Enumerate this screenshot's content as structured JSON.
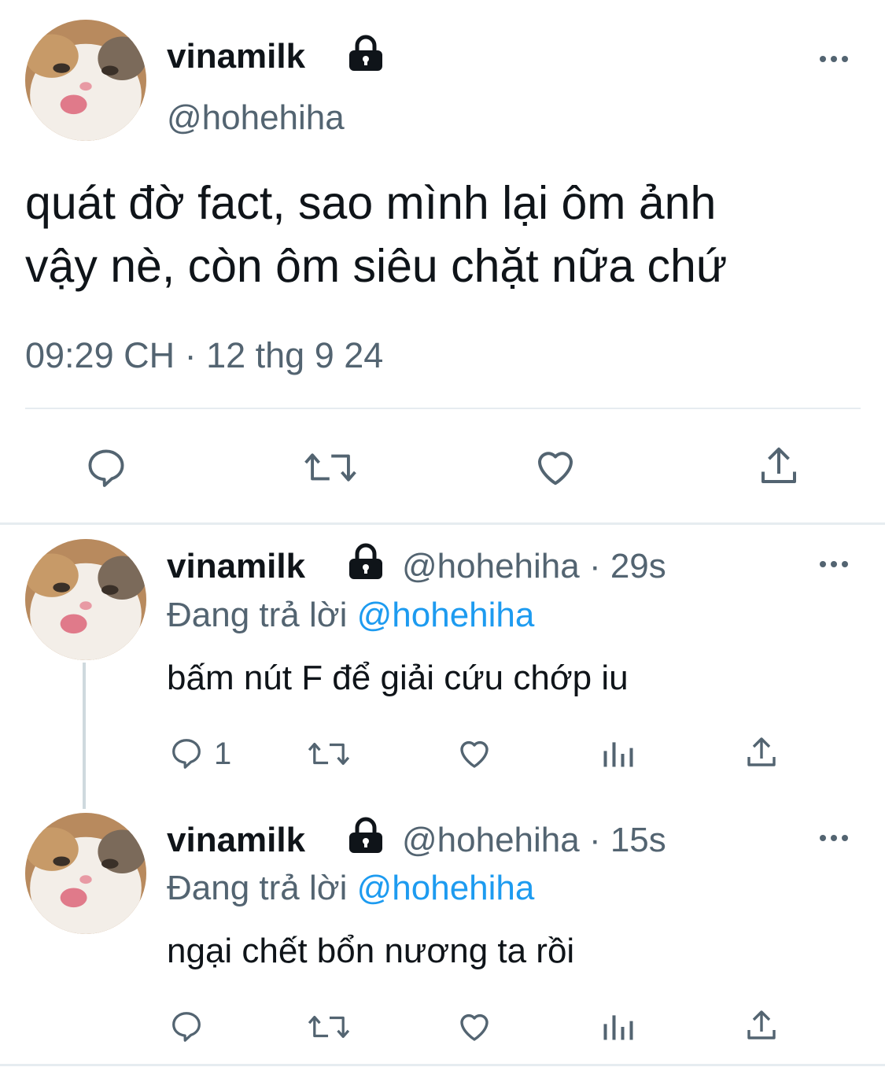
{
  "main_tweet": {
    "display_name": "vinamilk",
    "handle": "@hohehiha",
    "text_line1": "quát đờ fact, sao mình lại ôm ảnh",
    "text_line2": "vậy nè, còn ôm siêu chặt nữa chứ",
    "time": "09:29 CH · 12 thg 9 24",
    "actions": [
      "reply-icon",
      "retweet-icon",
      "like-icon",
      "share-icon"
    ]
  },
  "replies": [
    {
      "display_name": "vinamilk",
      "handle_time": "@hohehiha · 29s",
      "replying_prefix": "Đang trả lời",
      "replying_to": "@hohehiha",
      "text": "bấm nút F để giải cứu chớp iu",
      "reply_count": "1"
    },
    {
      "display_name": "vinamilk",
      "handle_time": "@hohehiha · 15s",
      "replying_prefix": "Đang trả lời",
      "replying_to": "@hohehiha",
      "text": "ngại chết bổn nương ta rồi",
      "reply_count": ""
    }
  ],
  "colors": {
    "text": "#0f1419",
    "secondary": "#536471",
    "accent": "#1d9bf0",
    "divider": "#e6ecf0"
  }
}
